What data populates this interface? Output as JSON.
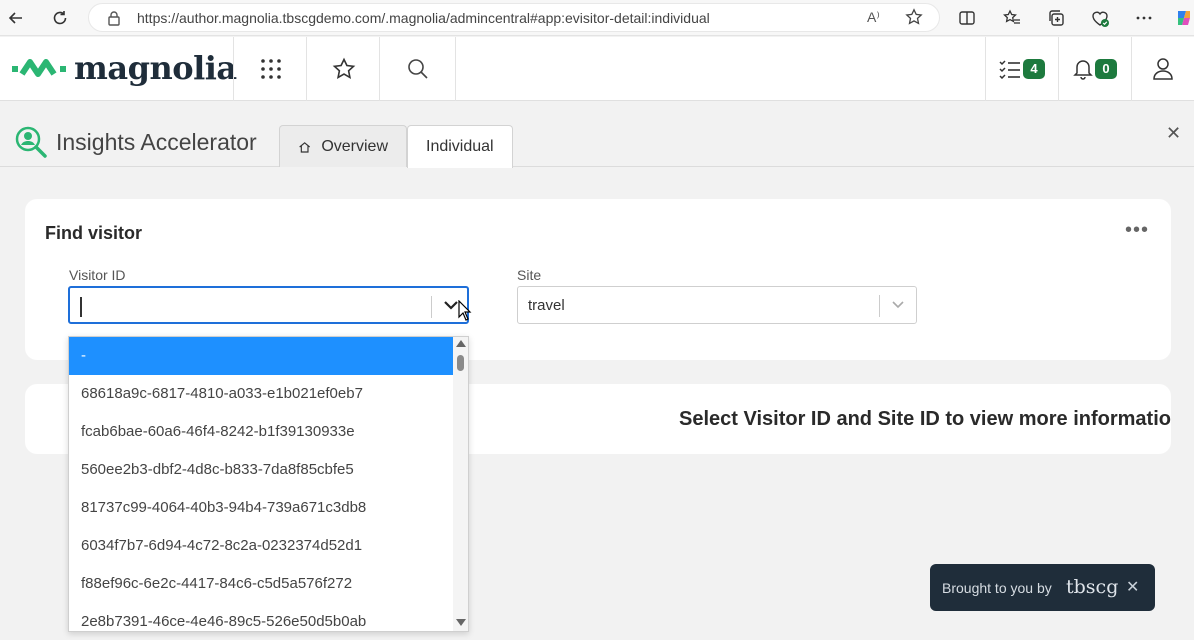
{
  "browser": {
    "url": "https://author.magnolia.tbscgdemo.com/.magnolia/admincentral#app:evisitor-detail:individual",
    "read_aloud_icon": "A⁾"
  },
  "header": {
    "logo_text": "magnolia",
    "tasks_count": "4",
    "notifications_count": "0"
  },
  "app": {
    "title": "Insights Accelerator",
    "tabs": [
      {
        "label": "Overview"
      },
      {
        "label": "Individual"
      }
    ],
    "close_glyph": "✕"
  },
  "find_visitor": {
    "title": "Find visitor",
    "more_glyph": "•••",
    "visitor_id_label": "Visitor ID",
    "visitor_id_value": "",
    "site_label": "Site",
    "site_value": "travel"
  },
  "info": {
    "message": "Select Visitor ID and Site ID to view more information"
  },
  "dropdown": {
    "options": [
      "-",
      "68618a9c-6817-4810-a033-e1b021ef0eb7",
      "fcab6bae-60a6-46f4-8242-b1f39130933e",
      "560ee2b3-dbf2-4d8c-b833-7da8f85cbfe5",
      "81737c99-4064-40b3-94b4-739a671c3db8",
      "6034f7b7-6d94-4c72-8c2a-0232374d52d1",
      "f88ef96c-6e2c-4417-84c6-c5d5a576f272",
      "2e8b7391-46ce-4e46-89c5-526e50d5b0ab"
    ],
    "selected_index": 0
  },
  "toast": {
    "text": "Brought to you by",
    "brand": "tbscg",
    "close_glyph": "✕"
  },
  "colors": {
    "accent_blue": "#1e90ff",
    "magnolia_green": "#1d7a3e",
    "toast_bg": "#1f2d3a"
  }
}
